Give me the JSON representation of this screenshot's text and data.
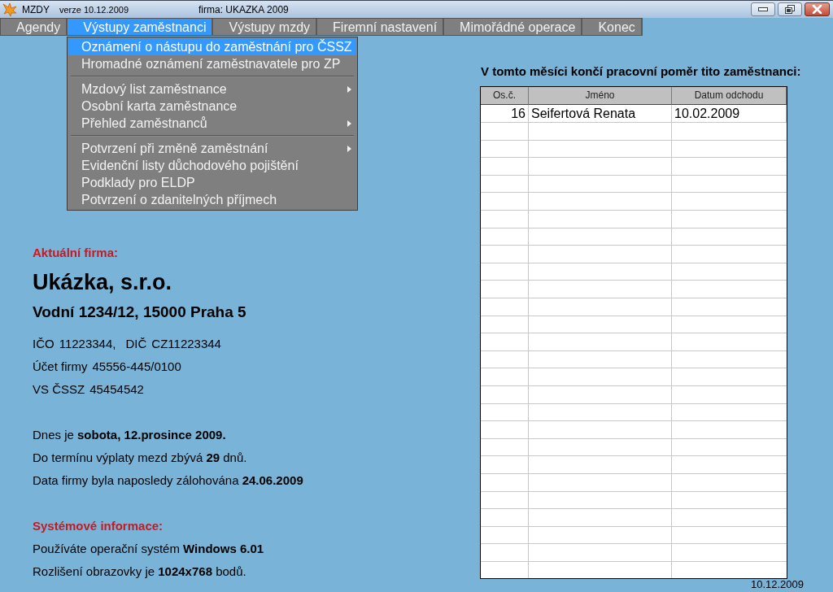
{
  "window": {
    "app": "MZDY",
    "version": "verze 10.12.2009",
    "company": "firma: UKAZKA 2009",
    "controls": [
      {
        "kind": "minimize"
      },
      {
        "kind": "restore"
      },
      {
        "kind": "close"
      }
    ]
  },
  "menu_bar": [
    {
      "label": "Agendy",
      "selected": false
    },
    {
      "label": "Výstupy zaměstnanci",
      "selected": true
    },
    {
      "label": "Výstupy mzdy",
      "selected": false
    },
    {
      "label": "Firemní nastavení",
      "selected": false
    },
    {
      "label": "Mimořádné operace",
      "selected": false
    },
    {
      "label": "Konec",
      "selected": false
    }
  ],
  "dropdown": {
    "items": [
      {
        "kind": "item",
        "label": "Oznámení o nástupu do zaměstnání pro ČSSZ",
        "selected": true,
        "submenu": false
      },
      {
        "kind": "item",
        "label": "Hromadné oznámení zaměstnavatele pro ZP",
        "selected": false,
        "submenu": false
      },
      {
        "kind": "separator"
      },
      {
        "kind": "item",
        "label": "Mzdový list zaměstnance",
        "selected": false,
        "submenu": true
      },
      {
        "kind": "item",
        "label": "Osobní karta zaměstnance",
        "selected": false,
        "submenu": false
      },
      {
        "kind": "item",
        "label": "Přehled zaměstnanců",
        "selected": false,
        "submenu": true
      },
      {
        "kind": "separator"
      },
      {
        "kind": "item",
        "label": "Potvrzení při změně zaměstnání",
        "selected": false,
        "submenu": true
      },
      {
        "kind": "item",
        "label": "Evidenční listy důchodového pojištění",
        "selected": false,
        "submenu": false
      },
      {
        "kind": "item",
        "label": "Podklady pro ELDP",
        "selected": false,
        "submenu": false
      },
      {
        "kind": "item",
        "label": "Potvrzení o zdanitelných příjmech",
        "selected": false,
        "submenu": false
      }
    ]
  },
  "company_section": {
    "heading": "Aktuální firma:",
    "name": "Ukázka, s.r.o.",
    "address": "Vodní 1234/12, 15000 Praha 5",
    "id_rows": [
      [
        {
          "label": "IČO",
          "value": "11223344,"
        },
        {
          "label": "DIČ",
          "value": "CZ11223344"
        }
      ],
      [
        {
          "label": "Účet firmy",
          "value": "45556-445/0100"
        }
      ],
      [
        {
          "label": "VS ČSSZ",
          "value": "45454542"
        }
      ]
    ]
  },
  "status_lines": [
    "Dnes je **sobota, 12.prosince 2009.**",
    "Do termínu výplaty mezd zbývá **29** dnů.",
    "Data firmy byla naposledy zálohována **24.06.2009**"
  ],
  "system_section": {
    "heading": "Systémové informace:",
    "lines": [
      "Používáte operační systém **Windows 6.01**",
      "Rozlišení obrazovky je **1024x768** bodů."
    ]
  },
  "ending_employees": {
    "title": "V tomto měsíci končí pracovní poměr tito zaměstnanci:",
    "table": {
      "columns": [
        "Os.č.",
        "Jméno",
        "Datum odchodu"
      ],
      "rows": [
        [
          "16",
          "Seifertová Renata",
          "10.02.2009"
        ]
      ]
    }
  },
  "footer_date": "10.12.2009"
}
